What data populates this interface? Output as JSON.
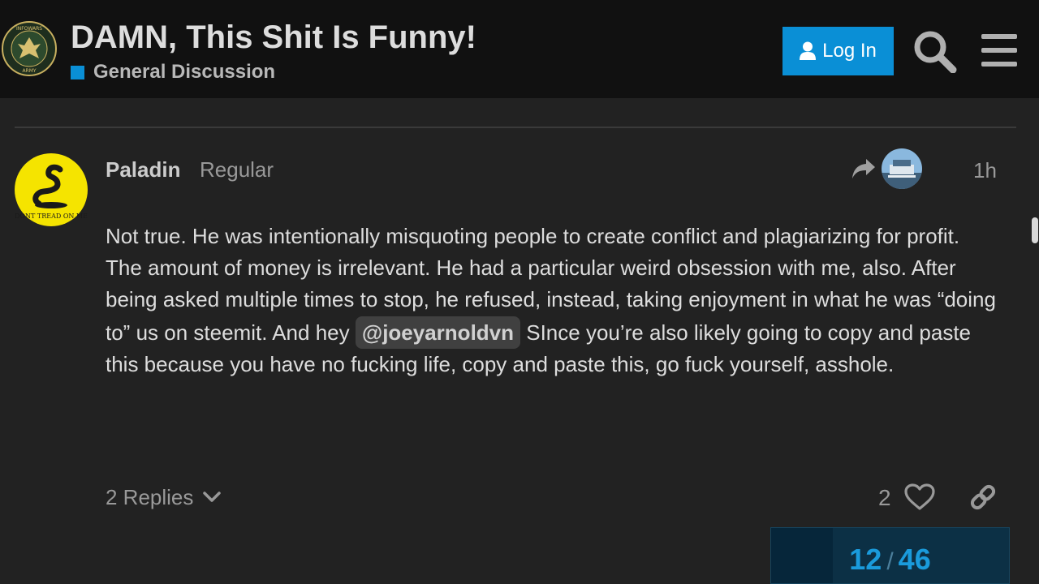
{
  "header": {
    "title": "DAMN, This Shit Is Funny!",
    "category": "General Discussion",
    "category_color": "#0a8fd6",
    "logo_text_top": "INFOWARS",
    "logo_text_bottom": "ARMY",
    "login_label": "Log In",
    "search_icon": "search-icon",
    "menu_icon": "hamburger-menu-icon"
  },
  "post": {
    "username": "Paladin",
    "user_title": "Regular",
    "avatar_text": "DONT TREAD ON ME",
    "time": "1h",
    "body_part1": "Not true. He was intentionally misquoting people to create conflict and plagiarizing for profit. The amount of money is irrelevant. He had a particular weird obsession with me, also. After being asked multiple times to stop, he refused, instead, taking enjoyment in what he was “doing to” us on steemit. And hey ",
    "mention": "@joeyarnoldvn",
    "body_part2": " SInce you’re also likely going to copy and paste this because you have no fucking life, copy and paste this, go fuck yourself, asshole.",
    "replies_label": "2 Replies",
    "like_count": "2"
  },
  "progress": {
    "current": "12",
    "total": "46",
    "fraction": 0.26
  },
  "colors": {
    "background": "#222222",
    "header": "#111111",
    "accent": "#0a8fd6"
  }
}
